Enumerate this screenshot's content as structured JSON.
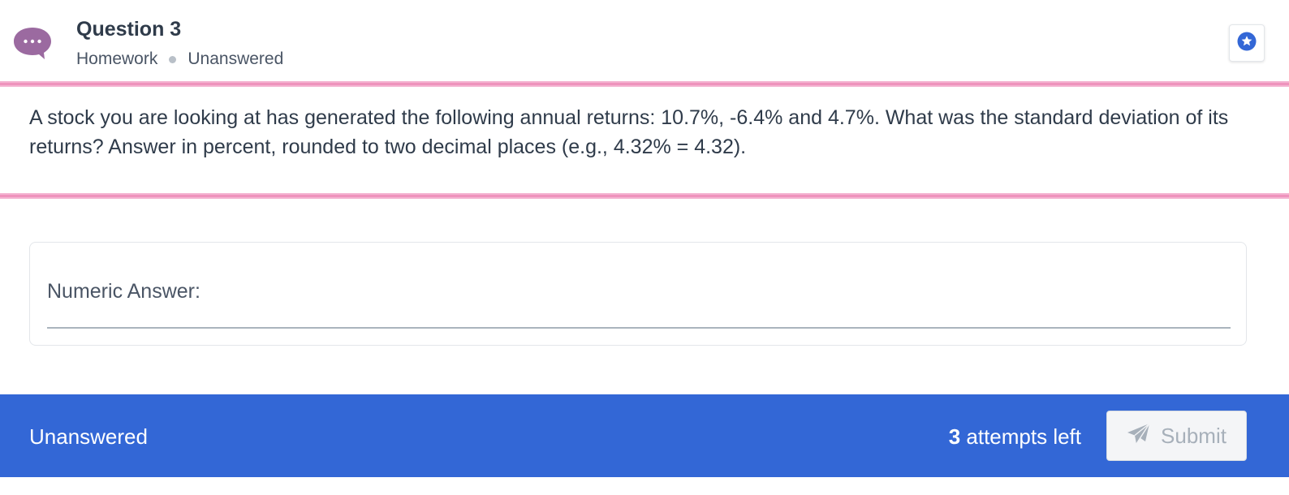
{
  "header": {
    "title": "Question 3",
    "category": "Homework",
    "status": "Unanswered",
    "icons": {
      "chat": "chat-bubble-icon",
      "star": "star-icon"
    },
    "colors": {
      "chat_icon": "#9b6aa0",
      "star_icon": "#3367d6"
    }
  },
  "question": {
    "text": "A stock you are looking at has generated the following annual returns: 10.7%, -6.4% and 4.7%. What was the standard deviation of its returns? Answer in percent, rounded to two decimal places (e.g., 4.32% = 4.32)."
  },
  "answer": {
    "label": "Numeric Answer:",
    "value": ""
  },
  "footer": {
    "status": "Unanswered",
    "attempts_count": "3",
    "attempts_text": " attempts left",
    "submit_label": "Submit",
    "submit_icon": "paper-plane-icon",
    "colors": {
      "background": "#3367d6",
      "submit_text": "#a7b0ba"
    }
  },
  "colors": {
    "accent_pink": "#ee93bd"
  }
}
